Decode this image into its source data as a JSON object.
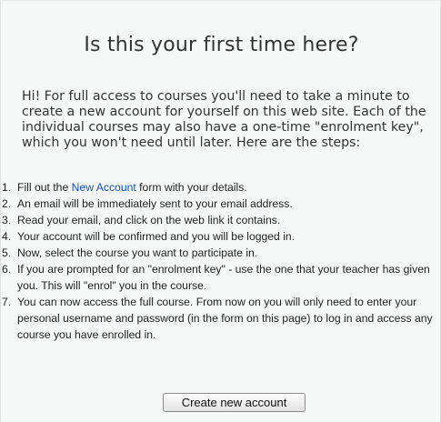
{
  "title": "Is this your first time here?",
  "intro": "Hi! For full access to courses you'll need to take a minute to create a new account for yourself on this web site. Each of the individual courses may also have a one-time \"enrolment key\", which you won't need until later. Here are the steps:",
  "steps": [
    {
      "num": "1.",
      "before": "Fill out the ",
      "link": "New Account",
      "after": " form with your details."
    },
    {
      "num": "2.",
      "text": "An email will be immediately sent to your email address."
    },
    {
      "num": "3.",
      "text": "Read your email, and click on the web link it contains."
    },
    {
      "num": "4.",
      "text": "Your account will be confirmed and you will be logged in."
    },
    {
      "num": "5.",
      "text": "Now, select the course you want to participate in."
    },
    {
      "num": "6.",
      "text": "If you are prompted for an \"enrolment key\" - use the one that your teacher has given you. This will \"enrol\" you in the course."
    },
    {
      "num": "7.",
      "text": "You can now access the full course. From now on you will only need to enter your personal username and password (in the form on this page) to log in and access any course you have enrolled in."
    }
  ],
  "button_label": "Create new account",
  "colors": {
    "link": "#0f55b6",
    "panel_bg": "#f6f8f7"
  }
}
